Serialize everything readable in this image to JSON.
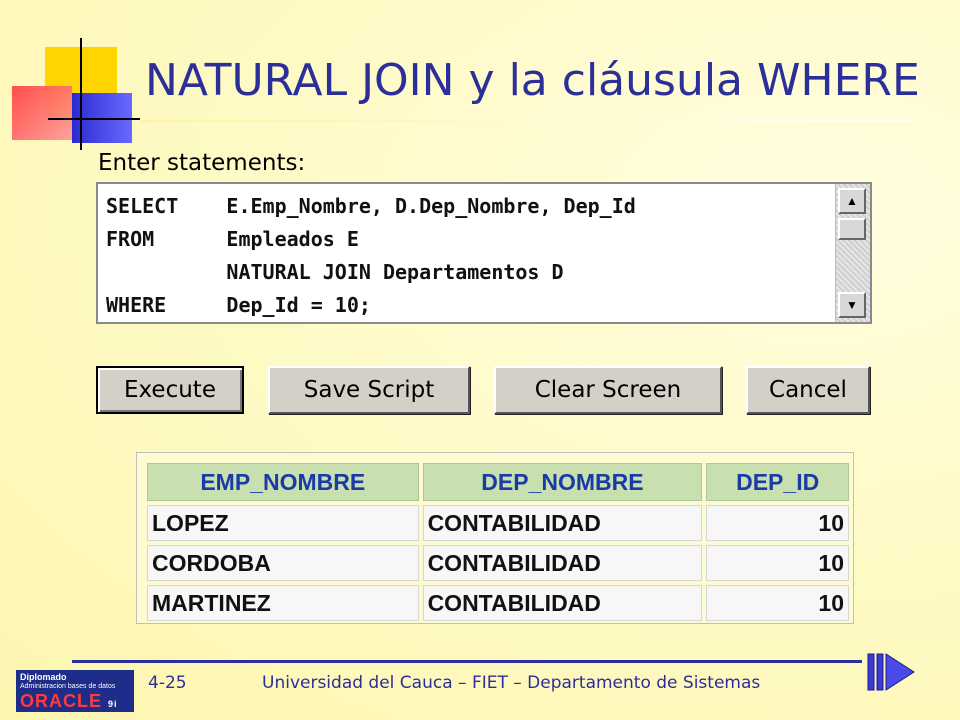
{
  "slide": {
    "title": "NATURAL JOIN y la cláusula WHERE",
    "page_number": "4-25",
    "footer": "Universidad del Cauca – FIET – Departamento de Sistemas"
  },
  "editor": {
    "label": "Enter statements:",
    "code": "SELECT    E.Emp_Nombre, D.Dep_Nombre, Dep_Id\nFROM      Empleados E\n          NATURAL JOIN Departamentos D\nWHERE     Dep_Id = 10;"
  },
  "buttons": {
    "execute": "Execute",
    "save_script": "Save Script",
    "clear_screen": "Clear Screen",
    "cancel": "Cancel"
  },
  "results": {
    "columns": [
      "EMP_NOMBRE",
      "DEP_NOMBRE",
      "DEP_ID"
    ],
    "rows": [
      [
        "LOPEZ",
        "CONTABILIDAD",
        "10"
      ],
      [
        "CORDOBA",
        "CONTABILIDAD",
        "10"
      ],
      [
        "MARTINEZ",
        "CONTABILIDAD",
        "10"
      ]
    ]
  },
  "logo": {
    "line1": "Diplomado",
    "line2": "Administracion bases de datos",
    "line3": "ORACLE",
    "line3_suffix": "9i TM"
  },
  "icons": {
    "scroll_up": "scroll-up-arrow-icon",
    "scroll_down": "scroll-down-arrow-icon",
    "next": "next-slide-arrow-icon"
  },
  "colors": {
    "title": "#2b2f9a",
    "header_bg": "#c8e0b0",
    "header_text": "#1a3aa6"
  }
}
